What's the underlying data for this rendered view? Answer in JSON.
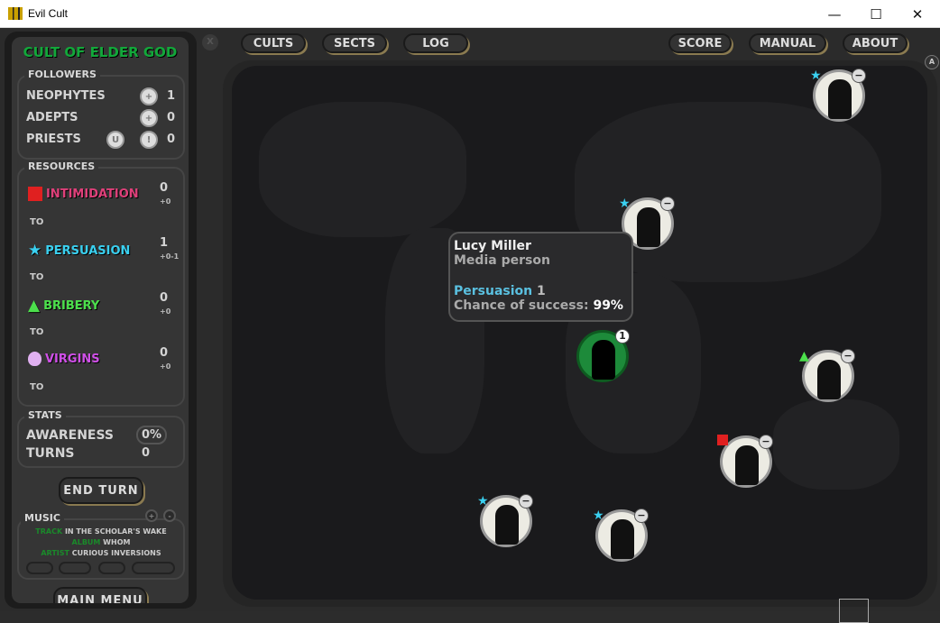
{
  "window": {
    "title": "Evil Cult",
    "minimize": "—",
    "maximize": "☐",
    "close": "✕"
  },
  "sidebar": {
    "cult_name": "CULT OF ELDER GOD",
    "followers": {
      "label": "FOLLOWERS",
      "rows": [
        {
          "name": "NEOPHYTES",
          "value": "1"
        },
        {
          "name": "ADEPTS",
          "value": "0"
        },
        {
          "name": "PRIESTS",
          "value": "0"
        }
      ],
      "upgrade_btn": "U",
      "call_btn": "!"
    },
    "resources": {
      "label": "RESOURCES",
      "to": "TO",
      "items": [
        {
          "name": "INTIMIDATION",
          "value": "0",
          "delta": "+0",
          "color": "#e0407a",
          "icon": "square"
        },
        {
          "name": "PERSUASION",
          "value": "1",
          "delta": "+0-1",
          "color": "#3ad0f0",
          "icon": "star"
        },
        {
          "name": "BRIBERY",
          "value": "0",
          "delta": "+0",
          "color": "#4ce04c",
          "icon": "triangle"
        },
        {
          "name": "VIRGINS",
          "value": "0",
          "delta": "+0",
          "color": "#d050e8",
          "icon": "lotus"
        }
      ]
    },
    "stats": {
      "label": "STATS",
      "awareness_label": "AWARENESS",
      "awareness": "0%",
      "turns_label": "TURNS",
      "turns": "0"
    },
    "end_turn": "END TURN",
    "music": {
      "label": "MUSIC",
      "track_label": "TRACK",
      "track": "IN THE SCHOLAR'S WAKE",
      "album_label": "ALBUM",
      "album": "WHOM",
      "artist_label": "ARTIST",
      "artist": "CURIOUS INVERSIONS"
    },
    "main_menu": "MAIN MENU"
  },
  "topbar": {
    "close": "X",
    "buttons": [
      "CULTS",
      "SECTS",
      "LOG",
      "SCORE",
      "MANUAL",
      "ABOUT"
    ],
    "advanced": "A"
  },
  "tooltip": {
    "name": "Lucy Miller",
    "role": "Media person",
    "resource": "Persuasion",
    "amount": "1",
    "chance_label": "Chance of success:",
    "chance": "99%"
  },
  "cult_node": {
    "level": "1"
  },
  "nodes": [
    {
      "marker": "star"
    },
    {
      "marker": "star"
    },
    {
      "marker": "triangle"
    },
    {
      "marker": "square"
    },
    {
      "marker": "star"
    },
    {
      "marker": "star"
    }
  ],
  "colors": {
    "cult_green": "#12a83a",
    "persuasion": "#3ad0f0",
    "intimidation": "#e02020",
    "bribery": "#4ce04c",
    "virgins": "#d050e8"
  }
}
